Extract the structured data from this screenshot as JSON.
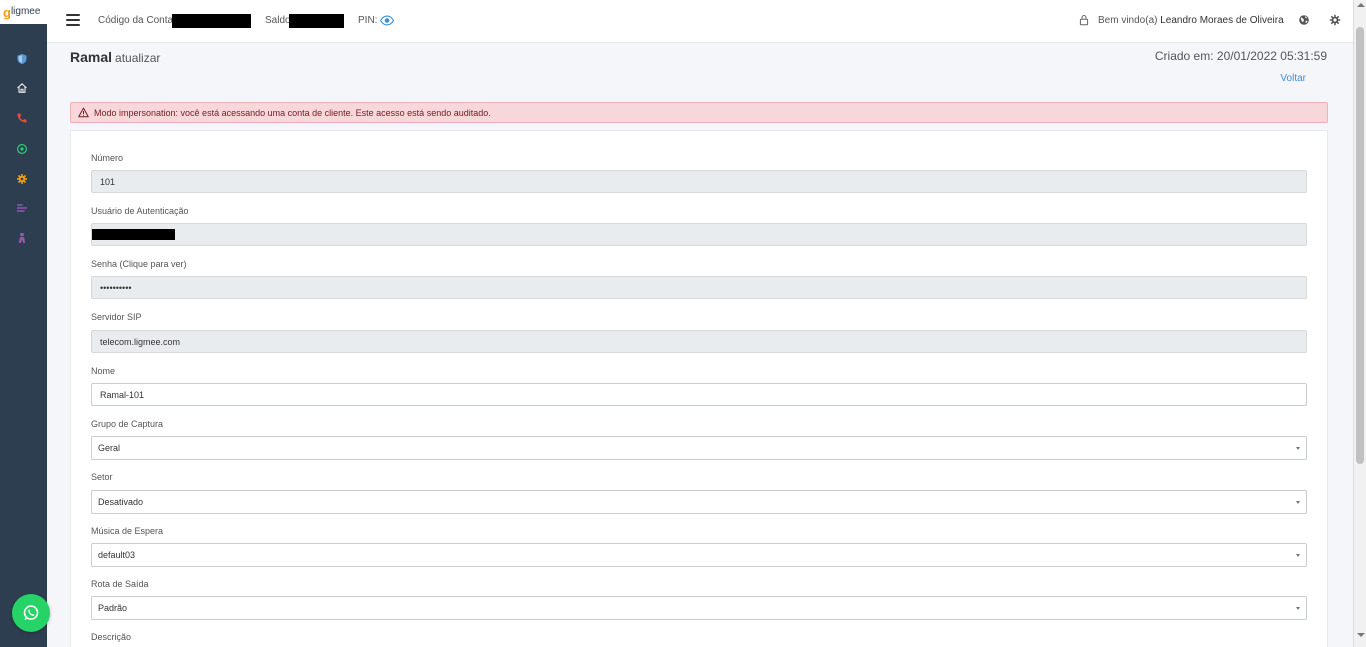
{
  "brand": {
    "logo_letter": "g",
    "logo_text": "ligmee",
    "accent": "#f39c12",
    "sidebar_bg": "#2c3e50"
  },
  "sidebar": {
    "items": [
      {
        "icon": "shield-icon",
        "color": "#5b9bd5"
      },
      {
        "icon": "home-icon",
        "color": "#e0e0e0"
      },
      {
        "icon": "phone-icon",
        "color": "#e74c3c"
      },
      {
        "icon": "whatsapp-icon",
        "color": "#2ecc71"
      },
      {
        "icon": "gear-icon",
        "color": "#f39c12"
      },
      {
        "icon": "list-icon",
        "color": "#9b59b6"
      },
      {
        "icon": "user-icon",
        "color": "#9b59b6"
      }
    ]
  },
  "topbar": {
    "account_label": "Código da Conta:",
    "balance_label": "Saldo",
    "pin_label": "PIN:",
    "welcome_label": "Bem vindo(a)",
    "user_name": "Leandro Moraes de Oliveira"
  },
  "page": {
    "title": "Ramal",
    "subtitle": "atualizar",
    "created": "Criado em: 20/01/2022 05:31:59",
    "back": "Voltar"
  },
  "alert": {
    "text": "Modo impersonation: você está acessando uma conta de cliente. Este acesso está sendo auditado."
  },
  "form": {
    "numero": {
      "label": "Número",
      "value": "101"
    },
    "usuario": {
      "label": "Usuário de Autenticação"
    },
    "senha": {
      "label": "Senha (Clique para ver)",
      "value": "••••••••••"
    },
    "servidor": {
      "label": "Servidor SIP",
      "value": "telecom.ligmee.com"
    },
    "nome": {
      "label": "Nome",
      "value": "Ramal-101"
    },
    "grupo": {
      "label": "Grupo de Captura",
      "value": "Geral"
    },
    "setor": {
      "label": "Setor",
      "value": "Desativado"
    },
    "musica": {
      "label": "Música de Espera",
      "value": "default03"
    },
    "rota": {
      "label": "Rota de Saída",
      "value": "Padrão"
    },
    "descricao": {
      "label": "Descrição"
    }
  }
}
